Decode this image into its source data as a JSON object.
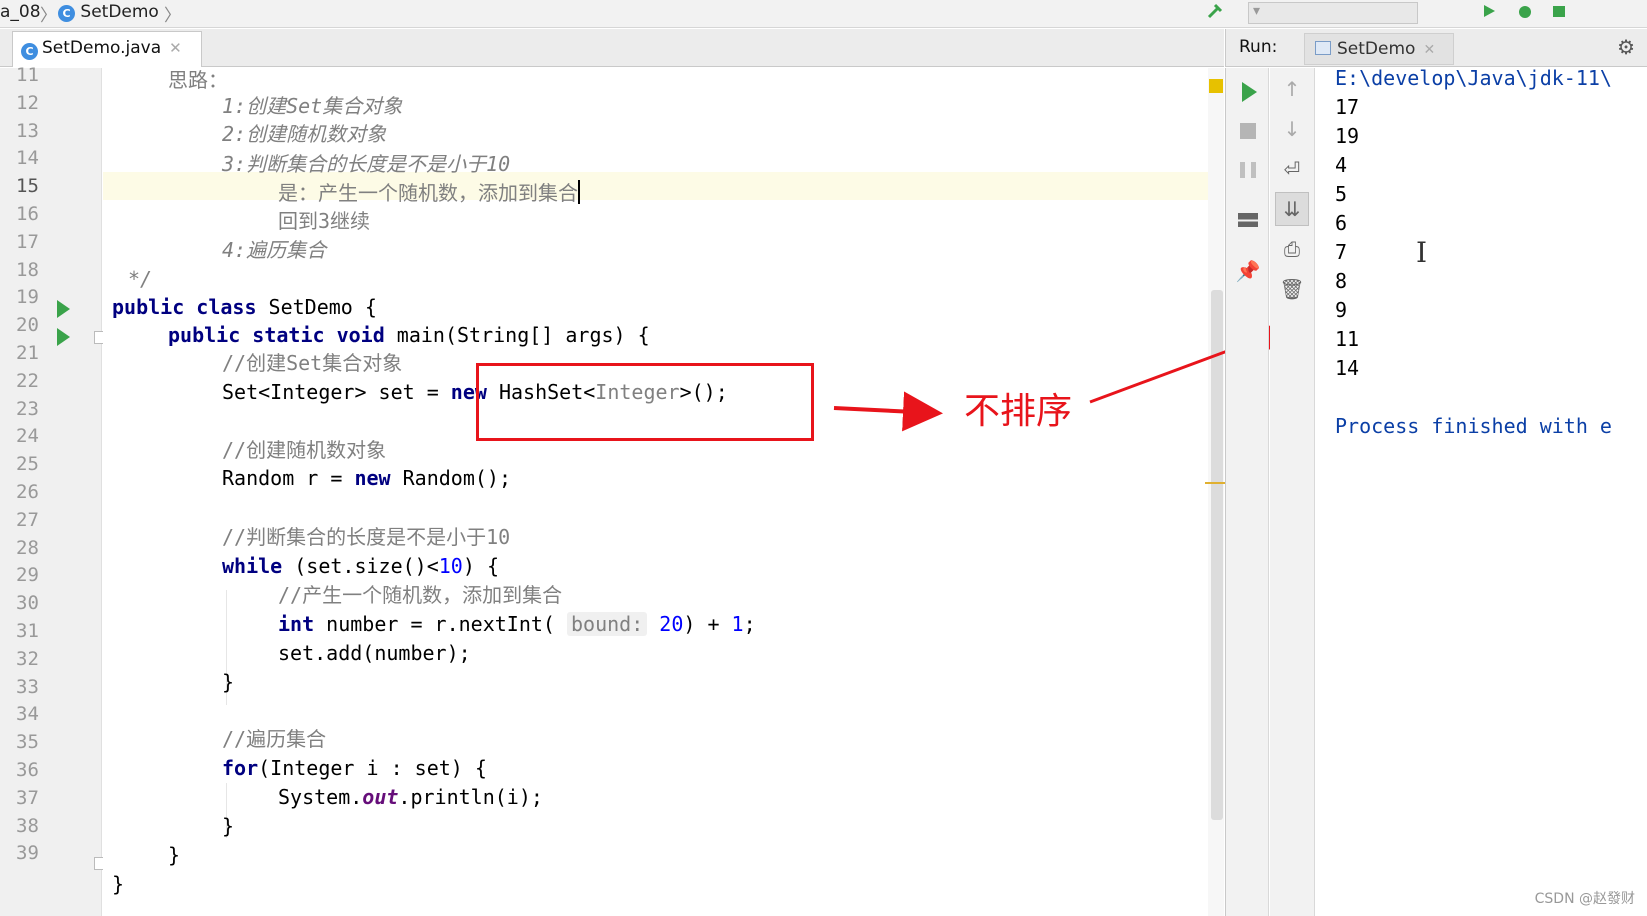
{
  "breadcrumb": {
    "module": "a_08",
    "file": "SetDemo"
  },
  "toolbar": {
    "run_config": "SetDemo",
    "icons": [
      "hammer-icon",
      "run-config-dropdown",
      "run-icon",
      "debug-icon",
      "coverage-icon"
    ]
  },
  "editor": {
    "tab_label": "SetDemo.java",
    "lines": [
      {
        "n": "11"
      },
      {
        "n": "12"
      },
      {
        "n": "13"
      },
      {
        "n": "14"
      },
      {
        "n": "15"
      },
      {
        "n": "16"
      },
      {
        "n": "17"
      },
      {
        "n": "18"
      },
      {
        "n": "19"
      },
      {
        "n": "20"
      },
      {
        "n": "21"
      },
      {
        "n": "22"
      },
      {
        "n": "23"
      },
      {
        "n": "24"
      },
      {
        "n": "25"
      },
      {
        "n": "26"
      },
      {
        "n": "27"
      },
      {
        "n": "28"
      },
      {
        "n": "29"
      },
      {
        "n": "30"
      },
      {
        "n": "31"
      },
      {
        "n": "32"
      },
      {
        "n": "33"
      },
      {
        "n": "34"
      },
      {
        "n": "35"
      },
      {
        "n": "36"
      },
      {
        "n": "37"
      },
      {
        "n": "38"
      },
      {
        "n": "39"
      }
    ],
    "code": {
      "l11": "思路：",
      "l12": "1:创建Set集合对象",
      "l13": "2:创建随机数对象",
      "l14": "3:判断集合的长度是不是小于10",
      "l15": "是：产生一个随机数，添加到集合",
      "l16": "回到3继续",
      "l17": "4:遍历集合",
      "l18": "*/",
      "l19_kw": "public class",
      "l19_rest": " SetDemo {",
      "l20_kw": "public static void",
      "l20_rest": " main(String[] args) {",
      "l21": "//创建Set集合对象",
      "l22_a": "Set<Integer> set = ",
      "l22_kw": "new",
      "l22_b": " HashSet<",
      "l22_gen": "Integer",
      "l22_c": ">();",
      "l24": "//创建随机数对象",
      "l25_a": "Random r = ",
      "l25_kw": "new",
      "l25_b": " Random();",
      "l27": "//判断集合的长度是不是小于10",
      "l28_kw": "while",
      "l28_a": " (set.size()<",
      "l28_num": "10",
      "l28_b": ") {",
      "l29": "//产生一个随机数，添加到集合",
      "l30_kw": "int",
      "l30_a": " number = r.nextInt( ",
      "l30_hint": "bound:",
      "l30_num": " 20",
      "l30_b": ") + ",
      "l30_num2": "1",
      "l30_c": ";",
      "l31": "set.add(number);",
      "l32": "}",
      "l34": "//遍历集合",
      "l35_kw": "for",
      "l35_a": "(Integer i : set) {",
      "l36_a": "System.",
      "l36_stat": "out",
      "l36_b": ".println(i);",
      "l37": "}",
      "l38": "}",
      "l39": "}"
    }
  },
  "annotation": {
    "label": "不排序",
    "color": "#e8141b"
  },
  "run_panel": {
    "label": "Run:",
    "tab_label": "SetDemo",
    "output": [
      "E:\\develop\\Java\\jdk-11\\",
      "17",
      "19",
      "4",
      "5",
      "6",
      "7",
      "8",
      "9",
      "11",
      "14",
      "",
      "Process finished with e"
    ]
  },
  "watermark": "CSDN @赵發财"
}
